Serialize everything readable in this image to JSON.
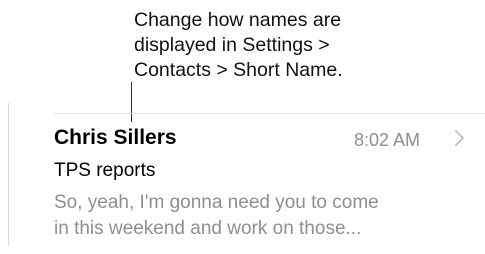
{
  "callout": {
    "lines": [
      "Change how names are",
      "displayed in Settings >",
      "Contacts > Short Name."
    ]
  },
  "message": {
    "sender": "Chris Sillers",
    "time": "8:02 AM",
    "subject": "TPS reports",
    "preview_lines": [
      "So, yeah, I'm gonna need you to come",
      "in this weekend and work on those..."
    ]
  },
  "icons": {
    "disclosure": "chevron-right-icon"
  },
  "colors": {
    "primary_text": "#000000",
    "secondary_text": "#8e8e93",
    "chevron": "#c4c4c8",
    "separator": "#e4e4e4"
  }
}
